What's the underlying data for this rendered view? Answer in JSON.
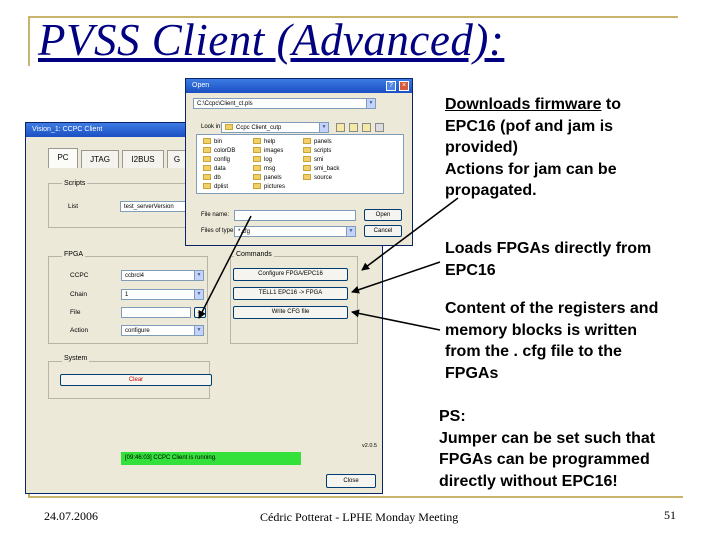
{
  "slide": {
    "title": "PVSS Client (Advanced):",
    "date": "24.07.2006",
    "footer_center": "Cédric Potterat - LPHE Monday Meeting",
    "page_number": "51"
  },
  "main_window": {
    "title": "Vision_1: CCPC Client",
    "tabs": [
      "PC",
      "JTAG",
      "I2BUS",
      "G"
    ],
    "scripts": {
      "group_label": "Scripts",
      "list_label": "List",
      "list_value": "test_serverVersion"
    },
    "fpga": {
      "group_label": "FPGA",
      "ccpc_label": "CCPC",
      "ccpc_value": "ccbrcl4",
      "chain_label": "Chain",
      "chain_value": "1",
      "file_label": "File",
      "file_value": "",
      "action_label": "Action",
      "action_value": "configure"
    },
    "commands": {
      "group_label": "Commands",
      "configure_label": "Configure FPGA/EPC16",
      "tell1_label": "TELL1 EPC16 -> FPGA",
      "write_label": "Write CFG file"
    },
    "system": {
      "group_label": "System",
      "clear_label": "Clear"
    },
    "version": "v2.0.5",
    "status_text": "[09:46:03] CCPC Client is running.",
    "close_label": "Close"
  },
  "open_dialog": {
    "title": "Open",
    "path_value": "C:\\Ccpc\\Client_ct.pls",
    "look_in_label": "Look in:",
    "look_in_value": "Ccpc Client_cutp",
    "files": [
      [
        "bin",
        "help",
        "panels"
      ],
      [
        "colorDB",
        "images",
        "scripts"
      ],
      [
        "config",
        "log",
        "smi"
      ],
      [
        "data",
        "msg",
        "smi_back"
      ],
      [
        "db",
        "panels",
        "source"
      ],
      [
        "dplist",
        "pictures",
        ""
      ]
    ],
    "file_name_label": "File name:",
    "file_name_value": "",
    "file_type_label": "Files of type:",
    "file_type_value": "*.cfg",
    "open_label": "Open",
    "cancel_label": "Cancel"
  },
  "annotations": {
    "a1_line1_underlined": "Downloads firmware",
    "a1_line1_rest": " to",
    "a1_line2": "EPC16 (pof and jam is",
    "a1_line3": "provided)",
    "a1_line4": "Actions for jam can be",
    "a1_line5": "propagated.",
    "a2_line1": "Loads FPGAs directly from",
    "a2_line2": "EPC16",
    "a3_line1": "Content of the registers and",
    "a3_line2": "memory blocks is written",
    "a3_line3": "from the . cfg file to the",
    "a3_line4": "FPGAs",
    "a4_line1": "PS:",
    "a4_line2": "Jumper can be set such that",
    "a4_line3": "FPGAs can be programmed",
    "a4_line4": "directly without EPC16!"
  },
  "colors": {
    "title_blue": "#000080",
    "frame_gold": "#c8b46a",
    "status_green": "#33e13a",
    "clear_red": "#cc0000"
  }
}
